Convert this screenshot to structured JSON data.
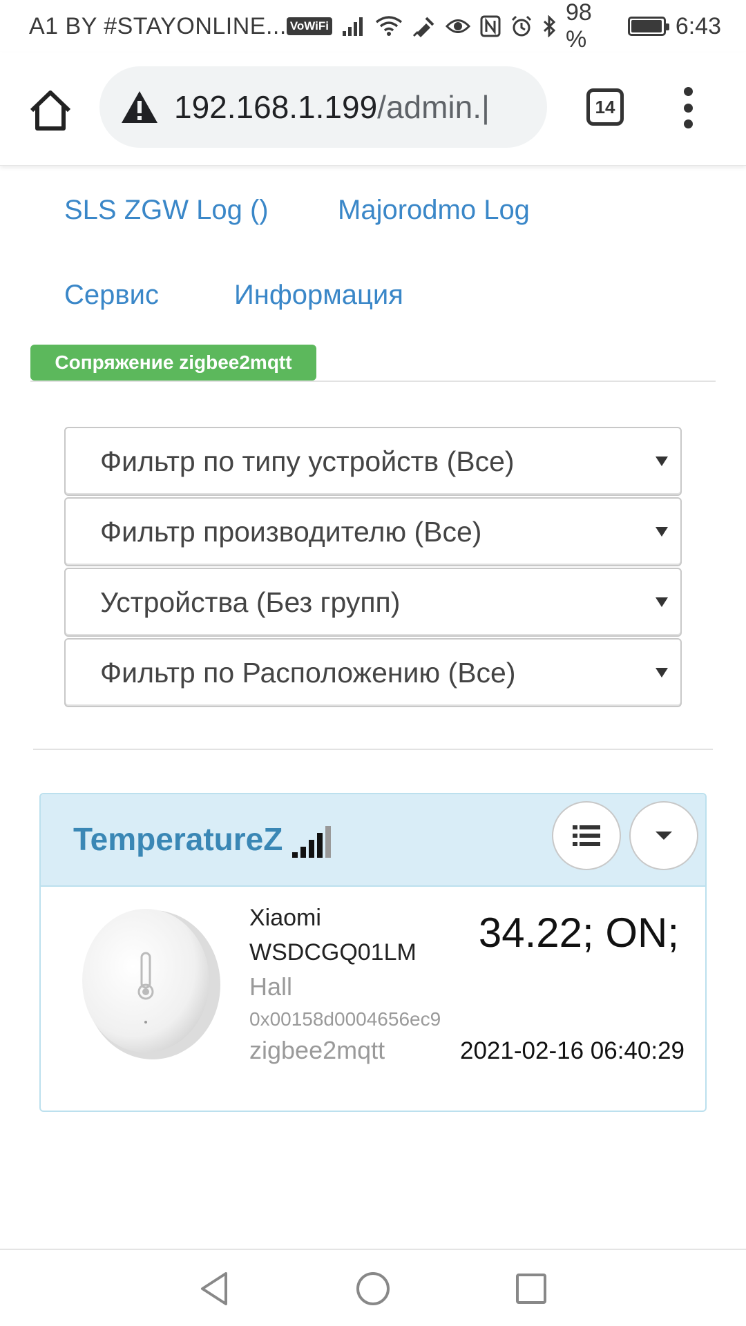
{
  "status_bar": {
    "carrier": "A1 BY #STAYONLINE...",
    "vowifi": "VoWiFi",
    "battery": "98 %",
    "battery_level": 0.98,
    "time": "6:43"
  },
  "browser": {
    "url_main": "192.168.1.199",
    "url_rest": "/admin.|",
    "tab_count": "14"
  },
  "nav": {
    "links": [
      "SLS ZGW Log ()",
      "Majorodmo Log",
      "Сервис",
      "Информация"
    ],
    "pair_button": "Сопряжение zigbee2mqtt"
  },
  "filters": [
    "Фильтр по типу устройств (Все)",
    "Фильтр производителю (Все)",
    "Устройства (Без групп)",
    "Фильтр по Расположению (Все)"
  ],
  "device": {
    "title": "TemperatureZ",
    "manufacturer": "Xiaomi",
    "model": "WSDCGQ01LM",
    "location": "Hall",
    "address": "0x00158d0004656ec9",
    "source": "zigbee2mqtt",
    "value": "34.22; ON;",
    "timestamp": "2021-02-16 06:40:29"
  },
  "colors": {
    "link": "#3a87c8",
    "pair_badge": "#5cb85c",
    "panel_header": "#d9edf7",
    "panel_border": "#bce0ee"
  }
}
